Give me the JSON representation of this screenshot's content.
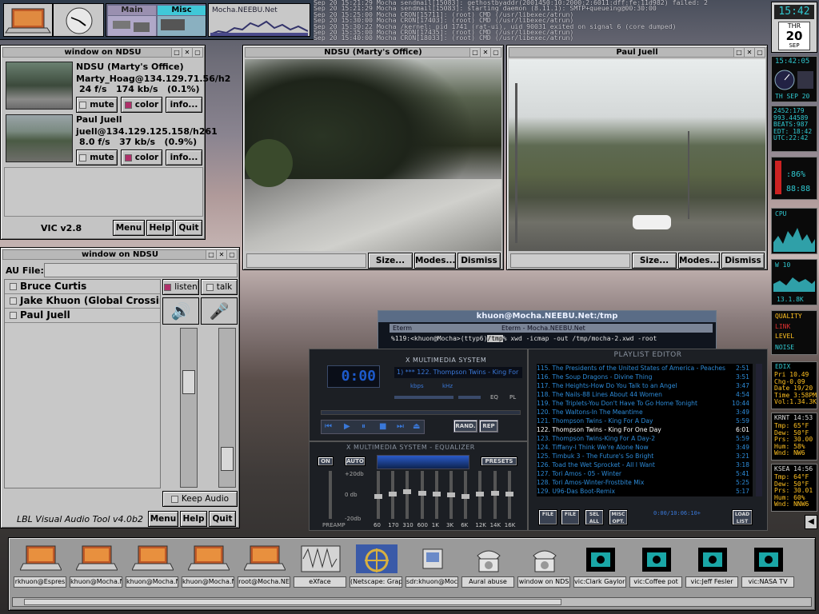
{
  "top_bar": {
    "pager_tabs": [
      "Main",
      "Misc"
    ],
    "applet_title": "Mocha.NEEBU.Net"
  },
  "terminal_log": [
    "Sep 20 15:21:29 Mocha sendmail[15083]: gethostbyaddr(2001450:10:2000:2:6011:dff:fe:11d982) failed: 2",
    "Sep 20 15:21:29 Mocha sendmail[15083]: starting daemon (8.11.1): SMTP+queueing@00:30:00",
    "Sep 20 15:25:00 Mocha CRON[15711]: (root) CMD (/usr/libexec/atrun)",
    "Sep 20 15:30:00 Mocha CRON[17403]: (root) CMD (/usr/libexec/atrun)",
    "Sep 20 15:30:22 Mocha /kernel: pid 1741 (rat-ui), uid 90031 exited on signal 6 (core dumped)",
    "Sep 20 15:35:00 Mocha CRON[17435]: (root) CMD (/usr/libexec/atrun)",
    "Sep 20 15:40:00 Mocha CRON[18033]: (root) CMD (/usr/libexec/atrun)"
  ],
  "vic_window": {
    "title": "window on NDSU",
    "streams": [
      {
        "name": "NDSU (Marty's Office)",
        "addr": "Marty_Hoag@134.129.71.56/h2",
        "stats": "24 f/s   174 kb/s   (0.1%)"
      },
      {
        "name": "Paul Juell",
        "addr": "juell@134.129.125.158/h261",
        "stats": "8.0 f/s   37 kb/s   (0.9%)"
      }
    ],
    "mute": "mute",
    "color": "color",
    "info": "info...",
    "version": "VIC v2.8",
    "menu": "Menu",
    "help": "Help",
    "quit": "Quit"
  },
  "video_windows": [
    {
      "title": "NDSU (Marty's Office)",
      "size": "Size...",
      "modes": "Modes...",
      "dismiss": "Dismiss"
    },
    {
      "title": "Paul Juell",
      "size": "Size...",
      "modes": "Modes...",
      "dismiss": "Dismiss"
    }
  ],
  "vat_window": {
    "title": "window on NDSU",
    "au_file_label": "AU File:",
    "participants": [
      "Bruce Curtis",
      "Jake Khuon (Global Crossing",
      "Paul Juell"
    ],
    "listen": "listen",
    "talk": "talk",
    "keep_audio": "Keep Audio",
    "version": "LBL Visual Audio Tool v4.0b2",
    "menu": "Menu",
    "help": "Help",
    "quit": "Quit"
  },
  "eterm": {
    "title": "khuon@Mocha.NEEBU.Net:/tmp",
    "tab": "Eterm",
    "subtitle": "Eterm - Mocha.NEEBU.Net",
    "prompt": "%119:<khuon@Mocha>(ttyp6)",
    "cwd": "/tmp",
    "command": "% xwd -icmap -out /tmp/mocha-2.xwd -root"
  },
  "xmms": {
    "title": "X MULTIMEDIA SYSTEM",
    "time": "0:00",
    "track": "1) *** 122. Thompson Twins - King For",
    "kbps": "kbps",
    "khz": "kHz",
    "eq_title": "X MULTIMEDIA SYSTEM - EQUALIZER",
    "on": "ON",
    "auto": "AUTO",
    "presets": "PRESETS",
    "db_labels": [
      "+20db",
      "0 db",
      "-20db"
    ],
    "preamp": "PREAMP",
    "bands": [
      "60",
      "170",
      "310",
      "600",
      "1K",
      "3K",
      "6K",
      "12K",
      "14K",
      "16K"
    ],
    "rand": "RAND.",
    "rep": "REP",
    "eq": "EQ",
    "pl": "PL"
  },
  "playlist": {
    "title": "PLAYLIST EDITOR",
    "current_index": 7,
    "items": [
      {
        "t": "115. The Presidents of the United States of America - Peaches",
        "d": "2:51"
      },
      {
        "t": "116. The Soup Dragons - Divine Thing",
        "d": "3:51"
      },
      {
        "t": "117. The Heights-How Do You Talk to an Angel",
        "d": "3:47"
      },
      {
        "t": "118. The Nails-88 Lines About 44 Women",
        "d": "4:54"
      },
      {
        "t": "119. The Triplets-You Don't Have To Go Home Tonight",
        "d": "10:44"
      },
      {
        "t": "120. The Waltons-In The Meantime",
        "d": "3:49"
      },
      {
        "t": "121. Thompson Twins - King For A Day",
        "d": "5:59"
      },
      {
        "t": "122. Thompson Twins - King For One Day",
        "d": "6:01"
      },
      {
        "t": "123. Thompson Twins-King For A Day-2",
        "d": "5:59"
      },
      {
        "t": "124. Tiffany-I Think We're Alone Now",
        "d": "3:49"
      },
      {
        "t": "125. Timbuk 3 - The Future's So Bright",
        "d": "3:21"
      },
      {
        "t": "126. Toad the Wet Sprocket - All I Want",
        "d": "3:18"
      },
      {
        "t": "127. Tori Amos - 05 - Winter",
        "d": "5:41"
      },
      {
        "t": "128. Tori Amos-Winter-Frostbite Mix",
        "d": "5:25"
      },
      {
        "t": "129. U96-Das Boot-Remix",
        "d": "5:17"
      }
    ],
    "buttons": [
      "FILE",
      "FILE",
      "SEL ALL",
      "MISC OPT.",
      "LOAD LIST"
    ],
    "time_display": "0:00/10:06:10+"
  },
  "clock": {
    "time": "15:42",
    "day": "THR",
    "date": "20",
    "month": "SEP"
  },
  "right_monitors": {
    "clock2": "15:42:05",
    "wheel_date": "TH SEP 20",
    "stats": [
      "2452:179",
      "993.44589",
      "BEATS:987",
      "EDT: 18:42",
      "UTC:22:42"
    ],
    "battery": ":86%",
    "battery2": "88:88",
    "cpu": "CPU",
    "net_label": "W 10",
    "net_val": "13.1.8K",
    "wifi": "QUALITY",
    "link": "LINK",
    "level": "LEVEL",
    "noise": "NOISE",
    "stock_title": "EDIX",
    "stock": [
      "Pri 10.49",
      "Chg-0.09",
      "Date 19/20",
      "Time 3:58PM",
      "Vol:1.34.3K"
    ],
    "wx1_title": "KRNT 14:53",
    "wx1": [
      "Tmp: 65°F",
      "Dew: 50°F",
      "Prs: 30.00",
      "Hum: 58%",
      "Wnd: NW6"
    ],
    "wx2_title": "KSEA 14:56",
    "wx2": [
      "Tmp: 64°F",
      "Dew: 50°F",
      "Prs: 30.01",
      "Hum: 60%",
      "Wnd: NNW6"
    ]
  },
  "dock": {
    "items": [
      {
        "label": "rkhuon@Espres",
        "kind": "laptop"
      },
      {
        "label": "khuon@Mocha.N",
        "kind": "laptop"
      },
      {
        "label": "khuon@Mocha.N",
        "kind": "laptop"
      },
      {
        "label": "khuon@Mocha.N",
        "kind": "laptop"
      },
      {
        "label": "root@Mocha.NE",
        "kind": "laptop"
      },
      {
        "label": "eXface",
        "kind": "wave"
      },
      {
        "label": "(Netscape: Graph",
        "kind": "wheel"
      },
      {
        "label": "sdr:khuon@Moc",
        "kind": "sdr"
      },
      {
        "label": "Aural abuse",
        "kind": "phone"
      },
      {
        "label": "window on NDS",
        "kind": "phone"
      },
      {
        "label": "vic:Clark Gaylord",
        "kind": "camera"
      },
      {
        "label": "vic:Coffee pot",
        "kind": "camera"
      },
      {
        "label": "vic:Jeff Fesler",
        "kind": "camera"
      },
      {
        "label": "vic:NASA TV",
        "kind": "camera"
      }
    ]
  }
}
